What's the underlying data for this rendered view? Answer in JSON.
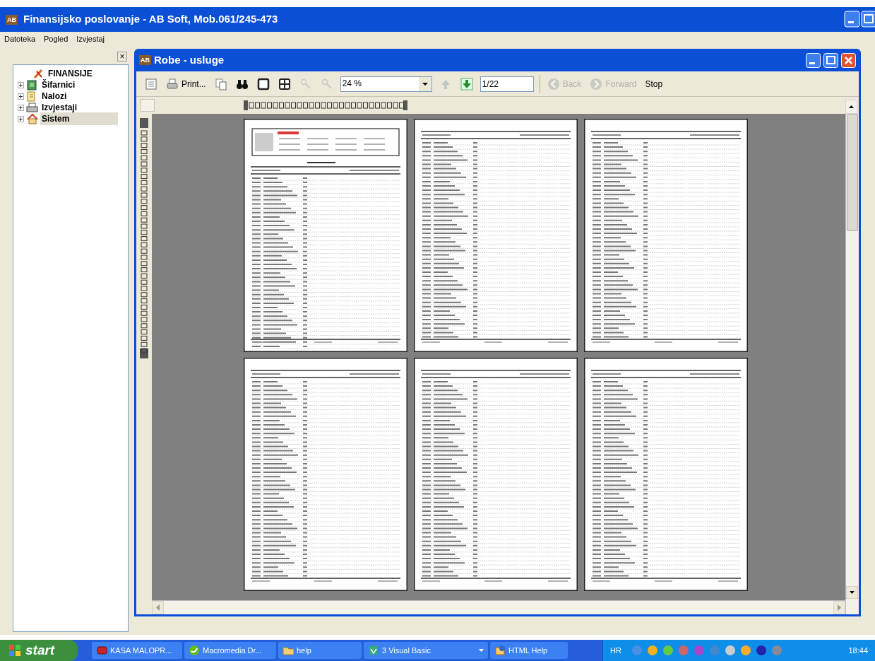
{
  "window": {
    "icon": "AB",
    "title": "Finansijsko poslovanje - AB Soft, Mob.061/245-473"
  },
  "menu": [
    "Datoteka",
    "Pogled",
    "Izvjestaj"
  ],
  "sidebar": {
    "close": "×",
    "items": [
      {
        "label": "FINANSIJE",
        "kind": "root",
        "selected": false
      },
      {
        "label": "Šifarnici",
        "kind": "folder",
        "expanded": false,
        "selected": false
      },
      {
        "label": "Nalozi",
        "kind": "orders",
        "expanded": false,
        "selected": false
      },
      {
        "label": "Izvjestaji",
        "kind": "printer",
        "expanded": false,
        "selected": false
      },
      {
        "label": "Sistem",
        "kind": "home",
        "expanded": false,
        "selected": true
      }
    ]
  },
  "report_window": {
    "icon": "AB",
    "title": "Robe - usluge",
    "toolbar": [
      {
        "kind": "toc",
        "disabled": false
      },
      {
        "kind": "print",
        "label": "Print...",
        "disabled": false
      },
      {
        "kind": "copy",
        "disabled": false
      },
      {
        "kind": "find",
        "disabled": false
      },
      {
        "kind": "single",
        "disabled": false
      },
      {
        "kind": "multi",
        "disabled": false
      },
      {
        "kind": "zoomin",
        "disabled": true
      },
      {
        "kind": "zoomout",
        "disabled": true
      },
      {
        "kind": "zoom",
        "value": "24 %"
      },
      {
        "kind": "prev",
        "disabled": true
      },
      {
        "kind": "next",
        "disabled": false
      },
      {
        "kind": "page",
        "value": "1/22"
      },
      {
        "kind": "back",
        "label": "Back",
        "disabled": true
      },
      {
        "kind": "forward",
        "label": "Forward",
        "disabled": true
      },
      {
        "kind": "stop",
        "label": "Stop",
        "disabled": false
      }
    ],
    "pages": [
      {
        "kind": "cover"
      },
      {
        "kind": "list"
      },
      {
        "kind": "list"
      },
      {
        "kind": "list"
      },
      {
        "kind": "list"
      },
      {
        "kind": "list"
      }
    ]
  },
  "taskbar": {
    "start": "start",
    "tasks": [
      {
        "label": "KASA MALOPR...",
        "kind": "book",
        "selected": false
      },
      {
        "label": "Macromedia Dr...",
        "kind": "dream",
        "selected": false
      },
      {
        "label": "help",
        "kind": "folder",
        "selected": false
      },
      {
        "label": "3 Visual Basic",
        "kind": "vb",
        "selected": false,
        "grouped": true
      },
      {
        "label": "HTML Help",
        "kind": "help",
        "selected": false
      }
    ],
    "language": "HR",
    "clock": "18:44"
  }
}
